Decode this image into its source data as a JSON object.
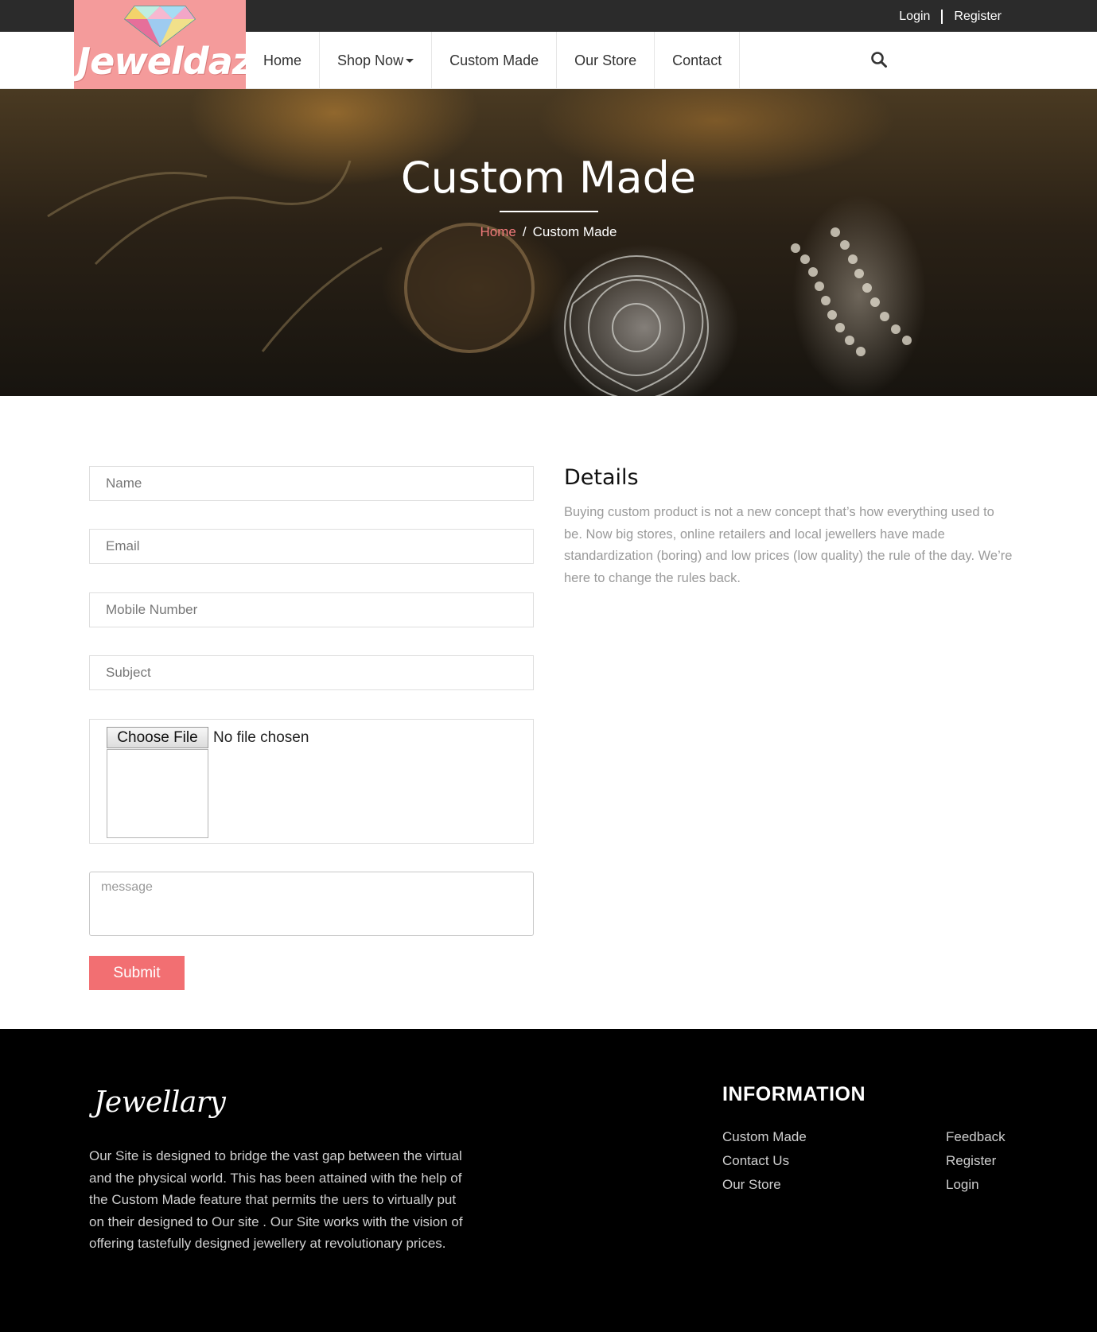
{
  "topbar": {
    "login_label": "Login",
    "register_label": "Register"
  },
  "brand": {
    "logo_text": "Jeweldaze",
    "logo_bg": "#f49b9b"
  },
  "nav": {
    "items": [
      {
        "label": "Home"
      },
      {
        "label": "Shop Now"
      },
      {
        "label": "Custom Made"
      },
      {
        "label": "Our Store"
      },
      {
        "label": "Contact"
      }
    ],
    "search_icon": "search-icon"
  },
  "hero": {
    "title": "Custom Made",
    "breadcrumb_home": "Home",
    "breadcrumb_sep": "/",
    "breadcrumb_current": "Custom Made"
  },
  "form": {
    "name_placeholder": "Name",
    "email_placeholder": "Email",
    "mobile_placeholder": "Mobile Number",
    "subject_placeholder": "Subject",
    "choose_file_label": "Choose File",
    "file_status": "No file chosen",
    "message_placeholder": "message",
    "submit_label": "Submit",
    "submit_color": "#f26f72"
  },
  "details": {
    "title": "Details",
    "text": "Buying custom product is not a new concept that’s how everything used to be. Now big stores, online retailers and local jewellers have made standardization (boring) and low prices (low quality) the rule of the day. We’re here to change the rules back."
  },
  "footer": {
    "logo_text": "Jewellary",
    "about": "Our Site is designed to bridge the vast gap between the virtual and the physical world. This has been attained with the help of the Custom Made feature that permits the uers to virtually put on their designed to Our site . Our Site works with the vision of offering tastefully designed jewellery at revolutionary prices.",
    "info_title": "INFORMATION",
    "links_col1": [
      "Custom Made",
      "Contact Us",
      "Our Store"
    ],
    "links_col2": [
      "Feedback",
      "Register",
      "Login"
    ]
  }
}
